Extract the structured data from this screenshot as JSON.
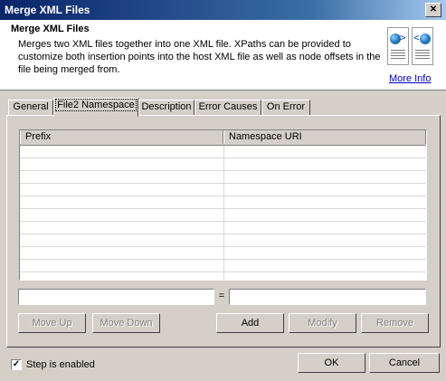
{
  "window": {
    "title": "Merge XML Files",
    "close_glyph": "✕"
  },
  "header": {
    "title": "Merge XML Files",
    "description": "Merges two XML files together into one XML file.  XPaths can be provided to customize both insertion points into the host XML file as well as node offsets in the file being merged from.",
    "more_info": "More Info",
    "icons": [
      "xml-output-document-icon",
      "xml-input-document-icon"
    ]
  },
  "tabs": [
    {
      "label": "General",
      "active": false
    },
    {
      "label": "File2 Namespace",
      "active": true
    },
    {
      "label": "Description",
      "active": false
    },
    {
      "label": "Error Causes",
      "active": false
    },
    {
      "label": "On Error",
      "active": false
    }
  ],
  "grid": {
    "columns": [
      "Prefix",
      "Namespace URI"
    ],
    "rows": []
  },
  "editor": {
    "prefix_value": "",
    "equals": "=",
    "uri_value": ""
  },
  "buttons": {
    "move_up": "Move Up",
    "move_down": "Move Down",
    "add": "Add",
    "modify": "Modify",
    "remove": "Remove",
    "ok": "OK",
    "cancel": "Cancel"
  },
  "footer": {
    "step_enabled_label": "Step is enabled",
    "step_enabled_checked": true,
    "check_glyph": "✓"
  },
  "colors": {
    "title_start": "#0a246a",
    "title_end": "#a6caf0",
    "face": "#d4d0c8",
    "link": "#0000cc"
  }
}
